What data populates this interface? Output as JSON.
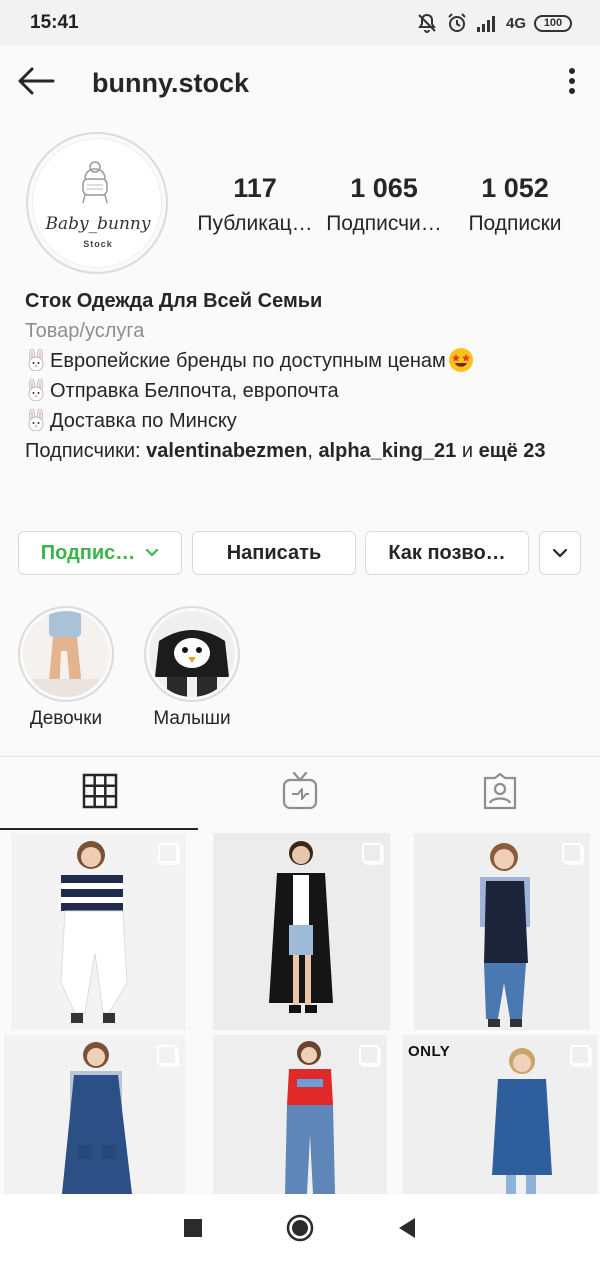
{
  "status_bar": {
    "time": "15:41",
    "network": "4G",
    "battery": "100"
  },
  "header": {
    "username": "bunny.stock"
  },
  "profile": {
    "avatar_text": "Baby_bunny",
    "avatar_subtext": "Stock",
    "stats": [
      {
        "value": "117",
        "label": "Публикац…"
      },
      {
        "value": "1 065",
        "label": "Подписчи…"
      },
      {
        "value": "1 052",
        "label": "Подписки"
      }
    ]
  },
  "bio": {
    "name": "Сток Одежда Для Всей Семьи",
    "category": "Товар/услуга",
    "lines": [
      "Европейские бренды по доступным ценам",
      "Отправка Белпочта, европочта",
      "Доставка по Минску"
    ],
    "followers_prefix": "Подписчики: ",
    "follower1": "valentinabezmen",
    "separator": ", ",
    "follower2": "alpha_king_21",
    "and": " и ",
    "more": "ещё 23"
  },
  "actions": {
    "follow": "Подпис…",
    "message": "Написать",
    "contact": "Как позво…"
  },
  "highlights": [
    {
      "label": "Девочки"
    },
    {
      "label": "Малыши"
    }
  ],
  "grid": {
    "brand_label": "ONLY"
  },
  "colors": {
    "accent_green": "#3ab54a",
    "text": "#262626",
    "muted": "#8e8e8e",
    "border": "#dbdbdb"
  },
  "icons": [
    "back-arrow-icon",
    "more-vertical-icon",
    "grid-icon",
    "igtv-icon",
    "tagged-icon",
    "chevron-down-icon",
    "multi-photo-icon",
    "nav-square-icon",
    "nav-circle-icon",
    "nav-triangle-icon"
  ]
}
